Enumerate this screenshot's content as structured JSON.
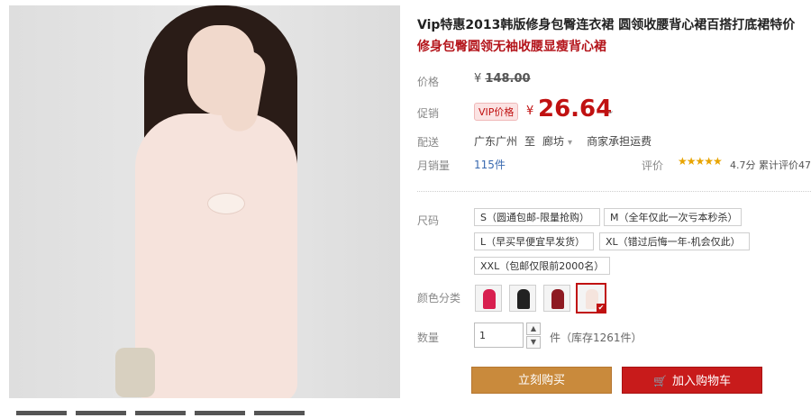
{
  "product": {
    "title_line1": "Vip特惠2013韩版修身包臀连衣裙 圆领收腰背心裙百搭打底裙特价",
    "title_line2": "修身包臀圆领无袖收腰显瘦背心裙"
  },
  "price": {
    "label": "价格",
    "currency": "¥",
    "original": "148.00"
  },
  "promo": {
    "label": "促销",
    "vip_badge": "VIP价格",
    "currency": "¥",
    "value": "26.64",
    "chevron": "⌄"
  },
  "shipping": {
    "label": "配送",
    "from": "广东广州",
    "to_word": "至",
    "to": "廊坊",
    "chevron": "▾",
    "fee": "商家承担运费"
  },
  "sales": {
    "label": "月销量",
    "value": "115件"
  },
  "evaluation": {
    "label": "评价",
    "stars": "★★★★★",
    "score_text": "4.7分 累计评价47"
  },
  "sizes": {
    "label": "尺码",
    "options": [
      "S（圆通包邮-限量抢购）",
      "M（全年仅此一次亏本秒杀）",
      "L（早买早便宜早发货）",
      "XL（错过后悔一年-机会仅此）",
      "XXL（包邮仅限前2000名）"
    ]
  },
  "colors": {
    "label": "颜色分类",
    "swatches": [
      "#d81f4f",
      "#222222",
      "#8e1a22",
      "#f5e4dd"
    ],
    "selected_index": 3,
    "check": "✔"
  },
  "quantity": {
    "label": "数量",
    "value": "1",
    "up": "▲",
    "down": "▼",
    "stock_text": "件（库存1261件）"
  },
  "actions": {
    "buy_now": "立刻购买",
    "add_to_cart": "加入购物车",
    "cart_icon": "🛒"
  }
}
